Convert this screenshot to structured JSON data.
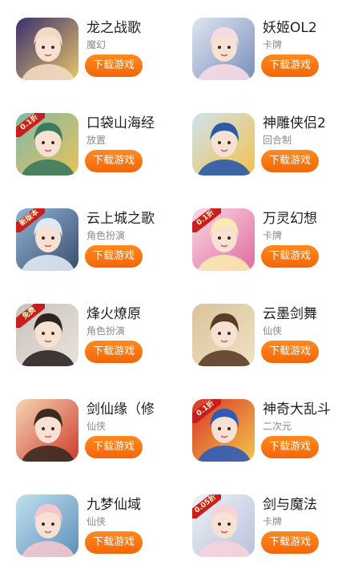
{
  "games": [
    {
      "name": "龙之战歌",
      "genre": "魔幻",
      "button": "下载游戏",
      "icon": "dragon-warsong-icon",
      "badge": "",
      "palette": [
        "#3a2f6e",
        "#f3d9c2",
        "#e9c46a"
      ]
    },
    {
      "name": "妖姬OL2",
      "genre": "卡牌",
      "button": "下载游戏",
      "icon": "demon-concubine-icon",
      "badge": "",
      "palette": [
        "#dfe6f3",
        "#f6dbe4",
        "#7a8fb8"
      ]
    },
    {
      "name": "口袋山海经",
      "genre": "放置",
      "button": "下载游戏",
      "icon": "pocket-shanhai-icon",
      "badge": "0.1折",
      "palette": [
        "#7fb9a8",
        "#3d7a5c",
        "#e8c35a"
      ]
    },
    {
      "name": "神雕侠侣2",
      "genre": "回合制",
      "button": "下载游戏",
      "icon": "condor-heroes-icon",
      "badge": "",
      "palette": [
        "#cfe3f1",
        "#2a5aa8",
        "#f1c24b"
      ]
    },
    {
      "name": "云上城之歌",
      "genre": "角色扮演",
      "button": "下载游戏",
      "icon": "cloud-city-song-icon",
      "badge": "新版本",
      "palette": [
        "#8fb3d6",
        "#dfe9f3",
        "#3b4e6d"
      ]
    },
    {
      "name": "万灵幻想",
      "genre": "卡牌",
      "button": "下载游戏",
      "icon": "spirit-fantasy-icon",
      "badge": "0.1折",
      "palette": [
        "#f7d9e4",
        "#fbeab0",
        "#e26aa0"
      ]
    },
    {
      "name": "烽火燎原",
      "genre": "角色扮演",
      "button": "下载游戏",
      "icon": "beacon-fire-icon",
      "badge": "免费",
      "palette": [
        "#c9c3bd",
        "#2d2522",
        "#e9e2da"
      ]
    },
    {
      "name": "云墨剑舞",
      "genre": "仙侠",
      "button": "下载游戏",
      "icon": "cloud-ink-sword-icon",
      "badge": "",
      "palette": [
        "#d9c39b",
        "#5a3d28",
        "#f1e2c4"
      ]
    },
    {
      "name": "剑仙缘（修",
      "genre": "仙侠",
      "button": "下载游戏",
      "icon": "sword-immortal-icon",
      "badge": "",
      "palette": [
        "#f4d6b3",
        "#3a2a22",
        "#d03a2c"
      ]
    },
    {
      "name": "神奇大乱斗",
      "genre": "二次元",
      "button": "下载游戏",
      "icon": "wonder-brawl-icon",
      "badge": "0.1折",
      "palette": [
        "#d8352a",
        "#2f5bb8",
        "#f3c64a"
      ]
    },
    {
      "name": "九梦仙域",
      "genre": "仙侠",
      "button": "下载游戏",
      "icon": "nine-dreams-icon",
      "badge": "",
      "palette": [
        "#bfe1ef",
        "#f2c6cf",
        "#5e8fb8"
      ]
    },
    {
      "name": "剑与魔法",
      "genre": "卡牌",
      "button": "下载游戏",
      "icon": "sword-magic-icon",
      "badge": "0.05折",
      "palette": [
        "#eef0f6",
        "#f6d3dc",
        "#b9c2db"
      ]
    }
  ]
}
